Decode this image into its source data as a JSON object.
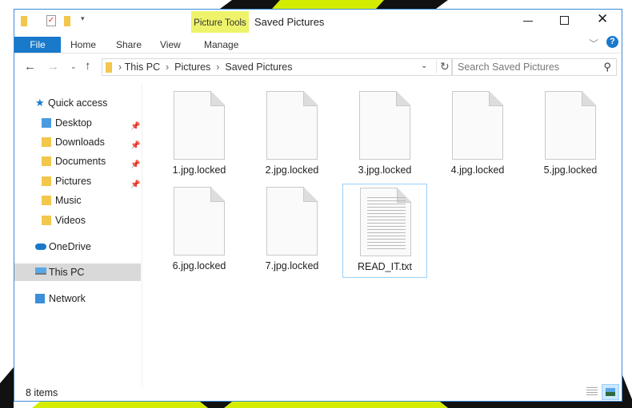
{
  "window": {
    "title": "Saved Pictures",
    "context_tab": "Picture Tools",
    "colors": {
      "accent": "#1979ca",
      "context": "#eef36b"
    }
  },
  "ribbon": {
    "tabs": [
      "File",
      "Home",
      "Share",
      "View",
      "Manage"
    ]
  },
  "address": {
    "path": [
      "This PC",
      "Pictures",
      "Saved Pictures"
    ]
  },
  "search": {
    "placeholder": "Search Saved Pictures"
  },
  "sidebar": {
    "items": [
      {
        "label": "Quick access",
        "icon": "star-icon"
      },
      {
        "label": "Desktop",
        "icon": "folder-icon",
        "pinned": true
      },
      {
        "label": "Downloads",
        "icon": "download-folder-icon",
        "pinned": true
      },
      {
        "label": "Documents",
        "icon": "documents-folder-icon",
        "pinned": true
      },
      {
        "label": "Pictures",
        "icon": "pictures-folder-icon",
        "pinned": true
      },
      {
        "label": "Music",
        "icon": "music-folder-icon"
      },
      {
        "label": "Videos",
        "icon": "videos-folder-icon"
      },
      {
        "label": "OneDrive",
        "icon": "cloud-icon"
      },
      {
        "label": "This PC",
        "icon": "computer-icon",
        "selected": true
      },
      {
        "label": "Network",
        "icon": "network-icon"
      }
    ]
  },
  "files": [
    "1.jpg.locked",
    "2.jpg.locked",
    "3.jpg.locked",
    "4.jpg.locked",
    "5.jpg.locked",
    "6.jpg.locked",
    "7.jpg.locked",
    "READ_IT.txt"
  ],
  "status": {
    "count": "8 items"
  }
}
